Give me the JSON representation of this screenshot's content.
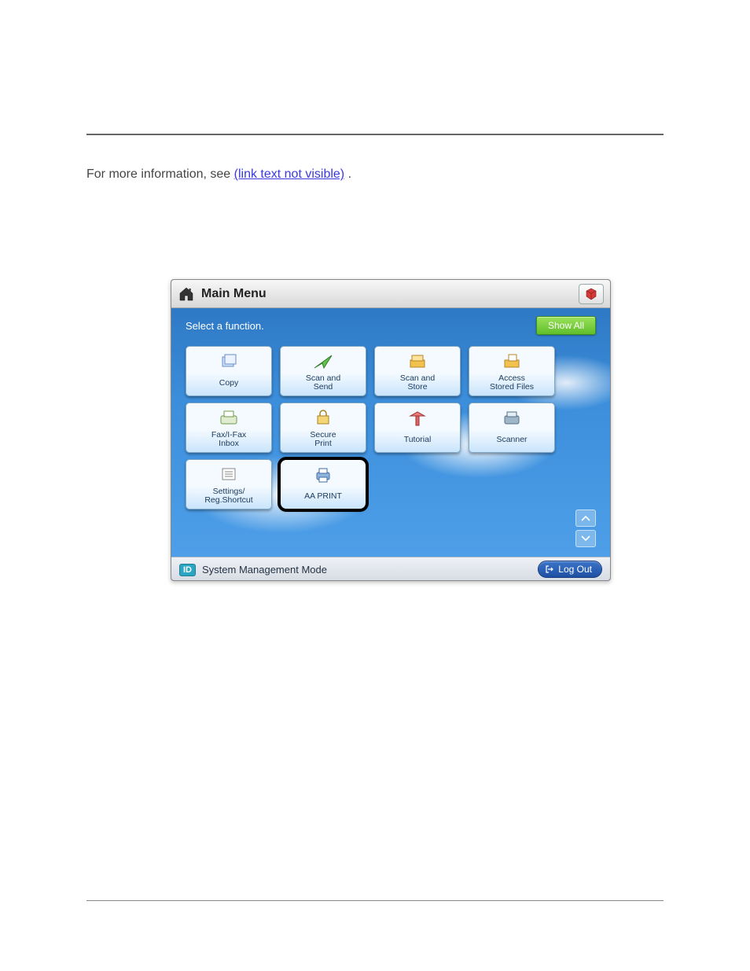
{
  "body": {
    "line1_prefix": "For more information, see ",
    "line1_link": "(link text not visible)",
    "line1_suffix": "."
  },
  "device": {
    "title": "Main Menu",
    "prompt": "Select a function.",
    "show_all": "Show All",
    "status_badge": "ID",
    "status_text": "System Management Mode",
    "logout": "Log Out",
    "apps": [
      {
        "id": "copy",
        "label": "Copy",
        "icon": "copy"
      },
      {
        "id": "scan-send",
        "label": "Scan and\nSend",
        "icon": "send"
      },
      {
        "id": "scan-store",
        "label": "Scan and\nStore",
        "icon": "store"
      },
      {
        "id": "access-files",
        "label": "Access\nStored Files",
        "icon": "files"
      },
      {
        "id": "fax-inbox",
        "label": "Fax/I-Fax\nInbox",
        "icon": "fax"
      },
      {
        "id": "secure-print",
        "label": "Secure\nPrint",
        "icon": "secure"
      },
      {
        "id": "tutorial",
        "label": "Tutorial",
        "icon": "tutorial"
      },
      {
        "id": "scanner",
        "label": "Scanner",
        "icon": "scanner"
      },
      {
        "id": "settings",
        "label": "Settings/\nReg.Shortcut",
        "icon": "settings"
      },
      {
        "id": "aa-print",
        "label": "AA PRINT",
        "icon": "printer",
        "highlight": true
      }
    ]
  }
}
